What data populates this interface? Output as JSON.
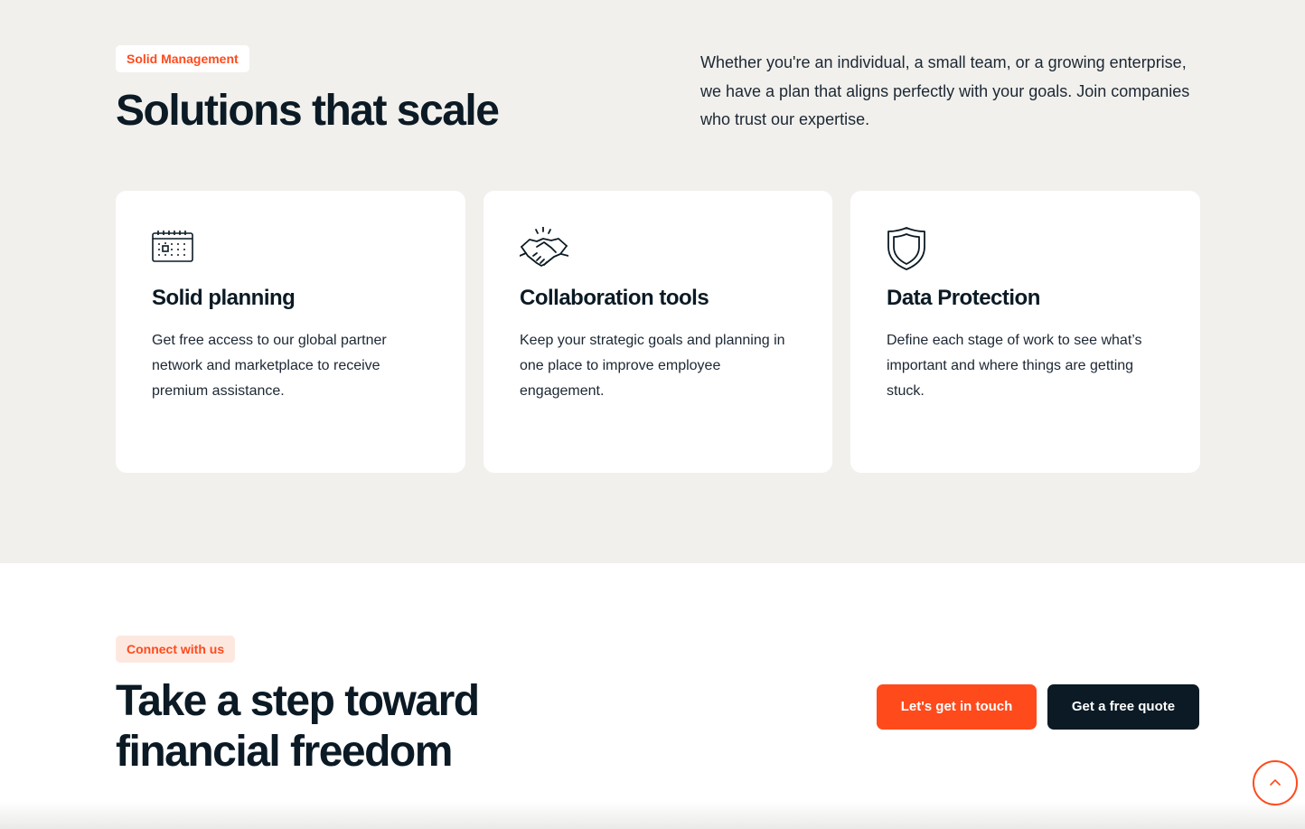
{
  "solutions": {
    "badge": "Solid Management",
    "title": "Solutions that scale",
    "intro": "Whether you're an individual, a small team, or a growing enterprise, we have a plan that aligns perfectly with your goals. Join companies who trust our expertise.",
    "cards": [
      {
        "icon": "calendar-icon",
        "title": "Solid planning",
        "text": "Get free access to our global partner network and marketplace to receive premium assistance."
      },
      {
        "icon": "handshake-icon",
        "title": "Collaboration tools",
        "text": "Keep your strategic goals and planning in one place to improve employee engagement."
      },
      {
        "icon": "shield-icon",
        "title": "Data Protection",
        "text": "Define each stage of work to see what’s important and where things are getting stuck."
      }
    ]
  },
  "connect": {
    "badge": "Connect with us",
    "title": "Take a step toward financial freedom",
    "primary_button": "Let's get in touch",
    "secondary_button": "Get a free quote"
  },
  "scroll_top": {
    "icon": "chevron-up-icon"
  },
  "colors": {
    "accent": "#ff4a1c",
    "dark": "#0b1a24",
    "section_bg": "#f1f0ed",
    "badge_peach": "#fde8e0"
  }
}
